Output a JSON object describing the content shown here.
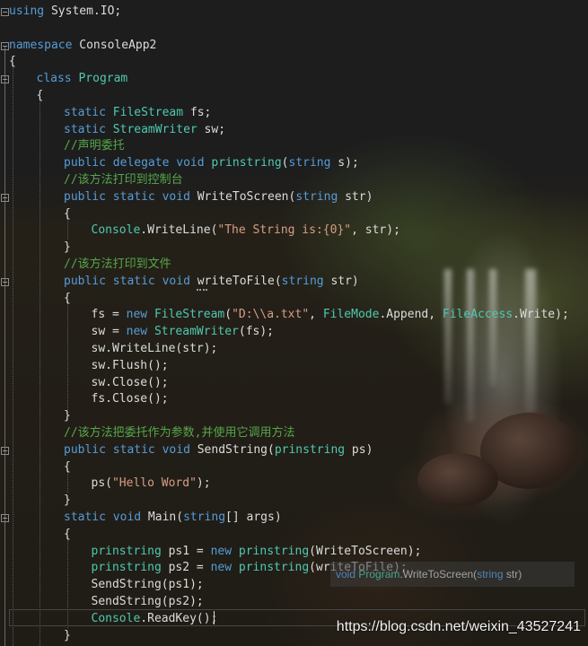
{
  "code_lines": [
    {
      "row": 0,
      "indent": 0,
      "parts": [
        [
          "kw",
          "using"
        ],
        [
          "id",
          " System.IO;"
        ]
      ]
    },
    {
      "row": 1,
      "indent": 0,
      "parts": []
    },
    {
      "row": 2,
      "indent": 0,
      "parts": [
        [
          "kw",
          "namespace"
        ],
        [
          "id",
          " ConsoleApp2"
        ]
      ]
    },
    {
      "row": 3,
      "indent": 0,
      "parts": [
        [
          "id",
          "{"
        ]
      ]
    },
    {
      "row": 4,
      "indent": 1,
      "parts": [
        [
          "kw",
          "class"
        ],
        [
          "id",
          " "
        ],
        [
          "ty",
          "Program"
        ]
      ]
    },
    {
      "row": 5,
      "indent": 1,
      "parts": [
        [
          "id",
          "{"
        ]
      ]
    },
    {
      "row": 6,
      "indent": 2,
      "parts": [
        [
          "kw",
          "static"
        ],
        [
          "id",
          " "
        ],
        [
          "ty",
          "FileStream"
        ],
        [
          "id",
          " fs;"
        ]
      ]
    },
    {
      "row": 7,
      "indent": 2,
      "parts": [
        [
          "kw",
          "static"
        ],
        [
          "id",
          " "
        ],
        [
          "ty",
          "StreamWriter"
        ],
        [
          "id",
          " sw;"
        ]
      ]
    },
    {
      "row": 8,
      "indent": 2,
      "parts": [
        [
          "com",
          "//声明委托"
        ]
      ]
    },
    {
      "row": 9,
      "indent": 2,
      "parts": [
        [
          "kw",
          "public"
        ],
        [
          "id",
          " "
        ],
        [
          "kw",
          "delegate"
        ],
        [
          "id",
          " "
        ],
        [
          "kw",
          "void"
        ],
        [
          "id",
          " "
        ],
        [
          "ty",
          "prinstring"
        ],
        [
          "id",
          "("
        ],
        [
          "kw",
          "string"
        ],
        [
          "id",
          " s);"
        ]
      ]
    },
    {
      "row": 10,
      "indent": 2,
      "parts": [
        [
          "com",
          "//该方法打印到控制台"
        ]
      ]
    },
    {
      "row": 11,
      "indent": 2,
      "parts": [
        [
          "kw",
          "public"
        ],
        [
          "id",
          " "
        ],
        [
          "kw",
          "static"
        ],
        [
          "id",
          " "
        ],
        [
          "kw",
          "void"
        ],
        [
          "id",
          " WriteToScreen("
        ],
        [
          "kw",
          "string"
        ],
        [
          "id",
          " str)"
        ]
      ]
    },
    {
      "row": 12,
      "indent": 2,
      "parts": [
        [
          "id",
          "{"
        ]
      ]
    },
    {
      "row": 13,
      "indent": 3,
      "parts": [
        [
          "ty",
          "Console"
        ],
        [
          "id",
          ".WriteLine("
        ],
        [
          "str",
          "\"The String is:{0}\""
        ],
        [
          "id",
          ", str);"
        ]
      ]
    },
    {
      "row": 14,
      "indent": 2,
      "parts": [
        [
          "id",
          "}"
        ]
      ]
    },
    {
      "row": 15,
      "indent": 2,
      "parts": [
        [
          "com",
          "//该方法打印到文件"
        ]
      ]
    },
    {
      "row": 16,
      "indent": 2,
      "parts": [
        [
          "kw",
          "public"
        ],
        [
          "id",
          " "
        ],
        [
          "kw",
          "static"
        ],
        [
          "id",
          " "
        ],
        [
          "kw",
          "void"
        ],
        [
          "id",
          " writeToFile("
        ],
        [
          "kw",
          "string"
        ],
        [
          "id",
          " str)"
        ]
      ]
    },
    {
      "row": 17,
      "indent": 2,
      "parts": [
        [
          "id",
          "{"
        ]
      ]
    },
    {
      "row": 18,
      "indent": 3,
      "parts": [
        [
          "id",
          "fs = "
        ],
        [
          "kw",
          "new"
        ],
        [
          "id",
          " "
        ],
        [
          "ty",
          "FileStream"
        ],
        [
          "id",
          "("
        ],
        [
          "str",
          "\"D:\\\\a.txt\""
        ],
        [
          "id",
          ", "
        ],
        [
          "ty",
          "FileMode"
        ],
        [
          "id",
          ".Append, "
        ],
        [
          "ty",
          "FileAccess"
        ],
        [
          "id",
          ".Write);"
        ]
      ]
    },
    {
      "row": 19,
      "indent": 3,
      "parts": [
        [
          "id",
          "sw = "
        ],
        [
          "kw",
          "new"
        ],
        [
          "id",
          " "
        ],
        [
          "ty",
          "StreamWriter"
        ],
        [
          "id",
          "(fs);"
        ]
      ]
    },
    {
      "row": 20,
      "indent": 3,
      "parts": [
        [
          "id",
          "sw.WriteLine(str);"
        ]
      ]
    },
    {
      "row": 21,
      "indent": 3,
      "parts": [
        [
          "id",
          "sw.Flush();"
        ]
      ]
    },
    {
      "row": 22,
      "indent": 3,
      "parts": [
        [
          "id",
          "sw.Close();"
        ]
      ]
    },
    {
      "row": 23,
      "indent": 3,
      "parts": [
        [
          "id",
          "fs.Close();"
        ]
      ]
    },
    {
      "row": 24,
      "indent": 2,
      "parts": [
        [
          "id",
          "}"
        ]
      ]
    },
    {
      "row": 25,
      "indent": 2,
      "parts": [
        [
          "com",
          "//该方法把委托作为参数,并使用它调用方法"
        ]
      ]
    },
    {
      "row": 26,
      "indent": 2,
      "parts": [
        [
          "kw",
          "public"
        ],
        [
          "id",
          " "
        ],
        [
          "kw",
          "static"
        ],
        [
          "id",
          " "
        ],
        [
          "kw",
          "void"
        ],
        [
          "id",
          " SendString("
        ],
        [
          "ty",
          "prinstring"
        ],
        [
          "id",
          " ps)"
        ]
      ]
    },
    {
      "row": 27,
      "indent": 2,
      "parts": [
        [
          "id",
          "{"
        ]
      ]
    },
    {
      "row": 28,
      "indent": 3,
      "parts": [
        [
          "id",
          "ps("
        ],
        [
          "str",
          "\"Hello Word\""
        ],
        [
          "id",
          ");"
        ]
      ]
    },
    {
      "row": 29,
      "indent": 2,
      "parts": [
        [
          "id",
          "}"
        ]
      ]
    },
    {
      "row": 30,
      "indent": 2,
      "parts": [
        [
          "kw",
          "static"
        ],
        [
          "id",
          " "
        ],
        [
          "kw",
          "void"
        ],
        [
          "id",
          " Main("
        ],
        [
          "kw",
          "string"
        ],
        [
          "id",
          "[] args)"
        ]
      ]
    },
    {
      "row": 31,
      "indent": 2,
      "parts": [
        [
          "id",
          "{"
        ]
      ]
    },
    {
      "row": 32,
      "indent": 3,
      "parts": [
        [
          "ty",
          "prinstring"
        ],
        [
          "id",
          " ps1 = "
        ],
        [
          "kw",
          "new"
        ],
        [
          "id",
          " "
        ],
        [
          "ty",
          "prinstring"
        ],
        [
          "id",
          "(WriteToScreen);"
        ]
      ]
    },
    {
      "row": 33,
      "indent": 3,
      "parts": [
        [
          "ty",
          "prinstring"
        ],
        [
          "id",
          " ps2 = "
        ],
        [
          "kw",
          "new"
        ],
        [
          "id",
          " "
        ],
        [
          "ty",
          "prinstring"
        ],
        [
          "id",
          "(writeToFile);"
        ]
      ]
    },
    {
      "row": 34,
      "indent": 3,
      "parts": [
        [
          "id",
          "SendString(ps1);"
        ]
      ]
    },
    {
      "row": 35,
      "indent": 3,
      "parts": [
        [
          "id",
          "SendString(ps2);"
        ]
      ]
    },
    {
      "row": 36,
      "indent": 3,
      "parts": [
        [
          "ty",
          "Console"
        ],
        [
          "id",
          ".ReadKey();"
        ]
      ]
    },
    {
      "row": 37,
      "indent": 2,
      "parts": [
        [
          "id",
          "}"
        ]
      ]
    }
  ],
  "fold_markers": [
    {
      "row": 0,
      "glyph": "−"
    },
    {
      "row": 2,
      "glyph": "−"
    },
    {
      "row": 4,
      "glyph": "−"
    },
    {
      "row": 11,
      "glyph": "−"
    },
    {
      "row": 16,
      "glyph": "−"
    },
    {
      "row": 26,
      "glyph": "−"
    },
    {
      "row": 30,
      "glyph": "−"
    }
  ],
  "tooltip": {
    "kw": "void",
    "type": "Program",
    "rest": ".WriteToScreen(",
    "param_kw": "string",
    "param": " str)"
  },
  "watermark": "https://blog.csdn.net/weixin_43527241",
  "colors": {
    "keyword": "#569cd6",
    "type": "#4ec9b0",
    "string": "#d69d85",
    "comment": "#57a64a",
    "text": "#dcdcdc",
    "background": "#1e1e1e"
  }
}
